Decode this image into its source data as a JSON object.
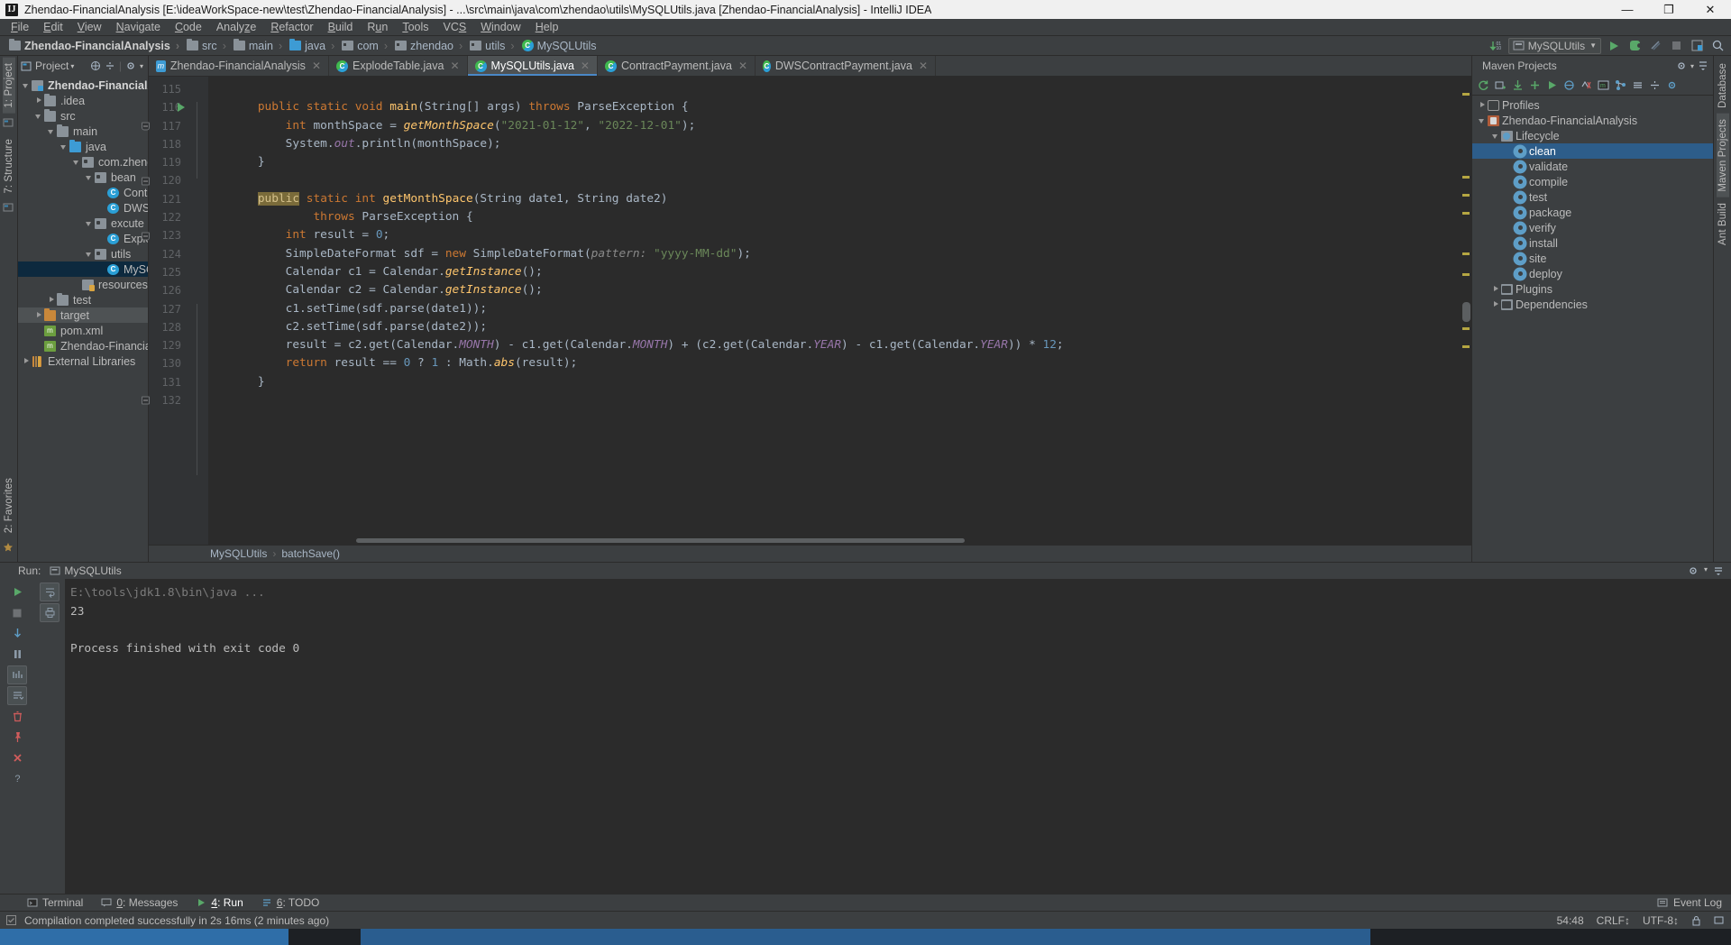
{
  "window": {
    "title": "Zhendao-FinancialAnalysis [E:\\ideaWorkSpace-new\\test\\Zhendao-FinancialAnalysis] - ...\\src\\main\\java\\com\\zhendao\\utils\\MySQLUtils.java [Zhendao-FinancialAnalysis] - IntelliJ IDEA",
    "logo": "IJ",
    "minimize": "—",
    "maximize": "❐",
    "close": "✕"
  },
  "menubar": {
    "items": [
      {
        "label": "File",
        "mnemonic": "F"
      },
      {
        "label": "Edit",
        "mnemonic": "E"
      },
      {
        "label": "View",
        "mnemonic": "V"
      },
      {
        "label": "Navigate",
        "mnemonic": "N"
      },
      {
        "label": "Code",
        "mnemonic": "C"
      },
      {
        "label": "Analyze",
        "mnemonic": "z"
      },
      {
        "label": "Refactor",
        "mnemonic": "R"
      },
      {
        "label": "Build",
        "mnemonic": "B"
      },
      {
        "label": "Run",
        "mnemonic": "u"
      },
      {
        "label": "Tools",
        "mnemonic": "T"
      },
      {
        "label": "VCS",
        "mnemonic": "S"
      },
      {
        "label": "Window",
        "mnemonic": "W"
      },
      {
        "label": "Help",
        "mnemonic": "H"
      }
    ]
  },
  "navbar": {
    "crumbs": [
      {
        "label": "Zhendao-FinancialAnalysis",
        "icon": "module-icon",
        "bold": true
      },
      {
        "label": "src",
        "icon": "folder-icon",
        "bold": false
      },
      {
        "label": "main",
        "icon": "folder-icon",
        "bold": false
      },
      {
        "label": "java",
        "icon": "source-folder-icon",
        "bold": false
      },
      {
        "label": "com",
        "icon": "package-icon",
        "bold": false
      },
      {
        "label": "zhendao",
        "icon": "package-icon",
        "bold": false
      },
      {
        "label": "utils",
        "icon": "package-icon",
        "bold": false
      },
      {
        "label": "MySQLUtils",
        "icon": "class-icon",
        "bold": false
      }
    ],
    "run_config": "MySQLUtils",
    "buttons": [
      "update-project-icon",
      "run-button",
      "debug-button",
      "coverage-button",
      "stop-button",
      "layout-button",
      "search-everywhere-icon"
    ]
  },
  "left_strip": {
    "tabs": [
      {
        "label": "1: Project",
        "active": true
      },
      {
        "label": "7: Structure",
        "active": false
      }
    ],
    "bottom_tabs": [
      {
        "label": "2: Favorites",
        "active": false
      }
    ]
  },
  "right_strip": {
    "tabs": [
      {
        "label": "Database",
        "active": false
      },
      {
        "label": "Maven Projects",
        "active": true
      },
      {
        "label": "Ant Build",
        "active": false
      }
    ]
  },
  "project_panel": {
    "title": "Project",
    "actions": [
      "collapse-all-icon",
      "scroll-from-source-icon",
      "settings-gear-icon",
      "hide-icon"
    ],
    "tree": [
      {
        "label": "Zhendao-FinancialAnalysis",
        "indent": 0,
        "arrow": "down",
        "icon": "module-icon",
        "bold": true,
        "selected": false
      },
      {
        "label": ".idea",
        "indent": 1,
        "arrow": "right",
        "icon": "folder-icon",
        "bold": false,
        "selected": false
      },
      {
        "label": "src",
        "indent": 1,
        "arrow": "down",
        "icon": "folder-icon",
        "bold": false,
        "selected": false
      },
      {
        "label": "main",
        "indent": 2,
        "arrow": "down",
        "icon": "folder-icon",
        "bold": false,
        "selected": false
      },
      {
        "label": "java",
        "indent": 3,
        "arrow": "down",
        "icon": "source-folder-icon",
        "bold": false,
        "selected": false
      },
      {
        "label": "com.zhendao",
        "indent": 4,
        "arrow": "down",
        "icon": "package-icon",
        "bold": false,
        "selected": false
      },
      {
        "label": "bean",
        "indent": 5,
        "arrow": "down",
        "icon": "package-icon",
        "bold": false,
        "selected": false
      },
      {
        "label": "ContractPayment",
        "indent": 6,
        "arrow": "none",
        "icon": "class-icon",
        "bold": false,
        "selected": false
      },
      {
        "label": "DWSContractPayment",
        "indent": 6,
        "arrow": "none",
        "icon": "class-icon",
        "bold": false,
        "selected": false
      },
      {
        "label": "excute",
        "indent": 5,
        "arrow": "down",
        "icon": "package-icon",
        "bold": false,
        "selected": false
      },
      {
        "label": "ExplodeTable",
        "indent": 6,
        "arrow": "none",
        "icon": "class-icon",
        "bold": false,
        "selected": false
      },
      {
        "label": "utils",
        "indent": 5,
        "arrow": "down",
        "icon": "package-icon",
        "bold": false,
        "selected": false
      },
      {
        "label": "MySQLUtils",
        "indent": 6,
        "arrow": "none",
        "icon": "class-icon",
        "bold": false,
        "selected": true
      },
      {
        "label": "resources",
        "indent": 4,
        "arrow": "none",
        "icon": "resources-folder-icon",
        "bold": false,
        "selected": false
      },
      {
        "label": "test",
        "indent": 2,
        "arrow": "right",
        "icon": "folder-icon",
        "bold": false,
        "selected": false
      },
      {
        "label": "target",
        "indent": 1,
        "arrow": "right",
        "icon": "target-folder-icon",
        "bold": false,
        "selected": false,
        "highlight": true
      },
      {
        "label": "pom.xml",
        "indent": 1,
        "arrow": "none",
        "icon": "maven-xml-icon",
        "bold": false,
        "selected": false
      },
      {
        "label": "Zhendao-FinancialAn",
        "indent": 1,
        "arrow": "none",
        "icon": "iml-icon",
        "bold": false,
        "selected": false
      },
      {
        "label": "External Libraries",
        "indent": 0,
        "arrow": "right",
        "icon": "library-icon",
        "bold": false,
        "selected": false
      }
    ]
  },
  "editor": {
    "tabs": [
      {
        "label": "Zhendao-FinancialAnalysis",
        "icon": "module-tab-icon",
        "active": false,
        "closable": true
      },
      {
        "label": "ExplodeTable.java",
        "icon": "class-icon",
        "active": false,
        "closable": true
      },
      {
        "label": "MySQLUtils.java",
        "icon": "class-icon",
        "active": true,
        "closable": true
      },
      {
        "label": "ContractPayment.java",
        "icon": "class-icon",
        "active": false,
        "closable": true
      },
      {
        "label": "DWSContractPayment.java",
        "icon": "class-icon",
        "active": false,
        "closable": true
      }
    ],
    "first_line": 115,
    "lines": [
      {
        "num": 115,
        "gutter": "",
        "fold": "",
        "html": ""
      },
      {
        "num": 116,
        "gutter": "run",
        "fold": "open",
        "html": "    <span class=\"k\">public static void</span> <span class=\"m\">main</span>(String[] args) <span class=\"k\">throws</span> ParseException {"
      },
      {
        "num": 117,
        "gutter": "",
        "fold": "",
        "html": "        <span class=\"k\">int</span> monthSpace = <span class=\"fi\">getMonthSpace</span>(<span class=\"s\">\"2021-01-12\"</span>, <span class=\"s\">\"2022-12-01\"</span>);"
      },
      {
        "num": 118,
        "gutter": "",
        "fold": "",
        "html": "        System.<span class=\"f\">out</span>.println(monthSpace);"
      },
      {
        "num": 119,
        "gutter": "",
        "fold": "close",
        "html": "    }"
      },
      {
        "num": 120,
        "gutter": "",
        "fold": "",
        "html": ""
      },
      {
        "num": 121,
        "gutter": "",
        "fold": "",
        "html": "    <span class=\"hl\">public</span> <span class=\"k\">static int</span> <span class=\"m\">getMonthSpace</span>(String date1, String date2)"
      },
      {
        "num": 122,
        "gutter": "",
        "fold": "open",
        "html": "            <span class=\"k\">throws</span> ParseException {"
      },
      {
        "num": 123,
        "gutter": "",
        "fold": "",
        "html": "        <span class=\"k\">int</span> result = <span class=\"n\">0</span>;"
      },
      {
        "num": 124,
        "gutter": "",
        "fold": "",
        "html": "        SimpleDateFormat sdf = <span class=\"k\">new</span> SimpleDateFormat(<span class=\"pk\">pattern:</span> <span class=\"s\">\"yyyy-MM-dd\"</span>);"
      },
      {
        "num": 125,
        "gutter": "",
        "fold": "",
        "html": "        Calendar c1 = Calendar.<span class=\"fi\">getInstance</span>();"
      },
      {
        "num": 126,
        "gutter": "",
        "fold": "",
        "html": "        Calendar c2 = Calendar.<span class=\"fi\">getInstance</span>();"
      },
      {
        "num": 127,
        "gutter": "",
        "fold": "",
        "html": "        c1.setTime(sdf.parse(date1));"
      },
      {
        "num": 128,
        "gutter": "",
        "fold": "",
        "html": "        c2.setTime(sdf.parse(date2));"
      },
      {
        "num": 129,
        "gutter": "",
        "fold": "",
        "html": "        result = c2.get(Calendar.<span class=\"f\">MONTH</span>) - c1.get(Calendar.<span class=\"f\">MONTH</span>) + (c2.get(Calendar.<span class=\"f\">YEAR</span>) - c1.get(Calendar.<span class=\"f\">YEAR</span>)) * <span class=\"n\">12</span>;"
      },
      {
        "num": 130,
        "gutter": "",
        "fold": "",
        "html": "        <span class=\"k\">return</span> result == <span class=\"n\">0</span> ? <span class=\"n\">1</span> : Math.<span class=\"fi\">abs</span>(result);"
      },
      {
        "num": 131,
        "gutter": "",
        "fold": "close",
        "html": "    }"
      },
      {
        "num": 132,
        "gutter": "",
        "fold": "",
        "html": ""
      }
    ],
    "breadcrumb": [
      "MySQLUtils",
      "batchSave()"
    ]
  },
  "maven_panel": {
    "title": "Maven Projects",
    "toolbar": [
      "refresh-icon",
      "add-maven-icon",
      "download-sources-icon",
      "add-icon",
      "run-maven-icon",
      "toggle-offline-icon",
      "skip-tests-icon",
      "execute-goal-icon",
      "show-dependencies-icon",
      "expand-all-icon",
      "collapse-all-icon",
      "settings-icon"
    ],
    "tree": [
      {
        "label": "Profiles",
        "indent": 0,
        "arrow": "right",
        "icon": "profiles-icon",
        "selected": false
      },
      {
        "label": "Zhendao-FinancialAnalysis",
        "indent": 0,
        "arrow": "down",
        "icon": "maven-module-icon",
        "selected": false
      },
      {
        "label": "Lifecycle",
        "indent": 1,
        "arrow": "down",
        "icon": "lifecycle-icon",
        "selected": false
      },
      {
        "label": "clean",
        "indent": 2,
        "arrow": "none",
        "icon": "phase-gear-icon",
        "selected": true
      },
      {
        "label": "validate",
        "indent": 2,
        "arrow": "none",
        "icon": "phase-gear-icon",
        "selected": false
      },
      {
        "label": "compile",
        "indent": 2,
        "arrow": "none",
        "icon": "phase-gear-icon",
        "selected": false
      },
      {
        "label": "test",
        "indent": 2,
        "arrow": "none",
        "icon": "phase-gear-icon",
        "selected": false
      },
      {
        "label": "package",
        "indent": 2,
        "arrow": "none",
        "icon": "phase-gear-icon",
        "selected": false
      },
      {
        "label": "verify",
        "indent": 2,
        "arrow": "none",
        "icon": "phase-gear-icon",
        "selected": false
      },
      {
        "label": "install",
        "indent": 2,
        "arrow": "none",
        "icon": "phase-gear-icon",
        "selected": false
      },
      {
        "label": "site",
        "indent": 2,
        "arrow": "none",
        "icon": "phase-gear-icon",
        "selected": false
      },
      {
        "label": "deploy",
        "indent": 2,
        "arrow": "none",
        "icon": "phase-gear-icon",
        "selected": false
      },
      {
        "label": "Plugins",
        "indent": 1,
        "arrow": "right",
        "icon": "plugins-icon",
        "selected": false
      },
      {
        "label": "Dependencies",
        "indent": 1,
        "arrow": "right",
        "icon": "dependencies-icon",
        "selected": false
      }
    ]
  },
  "run_panel": {
    "title": "Run:",
    "config_name": "MySQLUtils",
    "left_buttons": [
      "rerun-icon",
      "stop-icon",
      "resume-icon",
      "pause-icon",
      "trace-icon",
      "soft-wrap-icon",
      "scroll-to-end-icon",
      "print-icon",
      "clear-all-icon"
    ],
    "right_buttons": [
      "pin-icon",
      "close-icon",
      "help-icon"
    ],
    "header_actions": [
      "settings-gear-icon",
      "hide-icon"
    ],
    "console": [
      {
        "text": "E:\\tools\\jdk1.8\\bin\\java ...",
        "dim": true
      },
      {
        "text": "23",
        "dim": false
      },
      {
        "text": "",
        "dim": false
      },
      {
        "text": "Process finished with exit code 0",
        "dim": false
      }
    ]
  },
  "toolwindow_bar": {
    "items": [
      {
        "label": "Terminal",
        "icon": "terminal-icon",
        "active": false,
        "mnemonic": ""
      },
      {
        "label": "0: Messages",
        "icon": "messages-icon",
        "active": false,
        "mnemonic": "0"
      },
      {
        "label": "4: Run",
        "icon": "run-green-icon",
        "active": true,
        "mnemonic": "4"
      },
      {
        "label": "6: TODO",
        "icon": "todo-icon",
        "active": false,
        "mnemonic": "6"
      }
    ],
    "right": {
      "label": "Event Log",
      "icon": "event-log-icon"
    }
  },
  "statusbar": {
    "message": "Compilation completed successfully in 2s 16ms (2 minutes ago)",
    "position": "54:48",
    "line_sep": "CRLF↕",
    "encoding": "UTF-8↕",
    "lock_icon": "lock-icon",
    "inspection_icon": "inspection-icon"
  },
  "colors": {
    "accent": "#4a88c7",
    "selection": "#0d293e",
    "maven_selection": "#2d5d8a",
    "editor_bg": "#2b2b2b",
    "panel_bg": "#3c3f41",
    "keyword": "#cc7832",
    "string": "#6a8759",
    "number": "#6897bb",
    "method": "#ffc66d",
    "field": "#9876aa",
    "run_green": "#59a869"
  }
}
